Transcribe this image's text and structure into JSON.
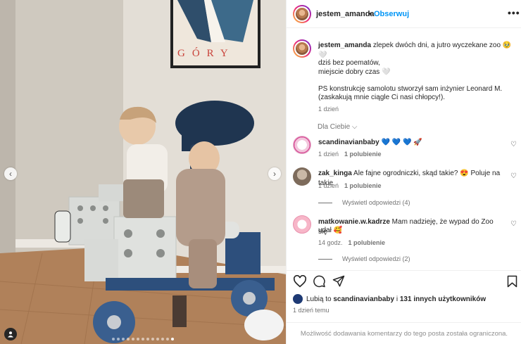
{
  "post": {
    "username": "jestem_amanda",
    "dot": "•",
    "follow_label": "Obserwuj",
    "more_label": "•••"
  },
  "photo": {
    "poster_text": "GÓRY",
    "prev_label": "‹",
    "next_label": "›",
    "dot_count": 13,
    "active_dot": 12
  },
  "caption": {
    "username": "jestem_amanda",
    "line1": "zlepek dwóch dni, a jutro wyczekane zoo 🥹 🤍",
    "line2": "dziś bez poematów,",
    "line3": "miejscie dobry czas 🤍",
    "line4": "PS konstrukcję samolotu stworzył sam inżynier Leonard M.",
    "line5": "(zaskakują mnie ciągle Ci nasi chłopcy!).",
    "time": "1 dzień",
    "sort_label": "Dla Ciebie ⌵"
  },
  "comments": [
    {
      "username": "scandinavianbaby",
      "text": "💙 💙 💙 🚀",
      "time": "1 dzień",
      "likes": "1 polubienie"
    },
    {
      "username": "zak_kinga",
      "text": "Ale fajne ogrodniczki, skąd takie? 😍 Poluje na takie",
      "time": "1 dzień",
      "likes": "1 polubienie",
      "replies": "Wyświetl odpowiedzi (4)"
    },
    {
      "username": "matkowanie.w.kadrze",
      "text": "Mam nadzieję, że wypad do Zoo się",
      "text2": "udał 🥰",
      "time": "14 godz.",
      "likes": "1 polubienie",
      "replies": "Wyświetl odpowiedzi (2)"
    }
  ],
  "likes": {
    "prefix": "Lubią to",
    "user": "scandinavianbaby",
    "middle": "i",
    "others": "131 innych użytkowników"
  },
  "date": "1 dzień temu",
  "comment_limit": "Możliwość dodawania komentarzy do tego posta została ograniczona.",
  "icons": {
    "heart": "heart-icon",
    "comment": "comment-icon",
    "share": "share-icon",
    "save": "bookmark-icon"
  }
}
